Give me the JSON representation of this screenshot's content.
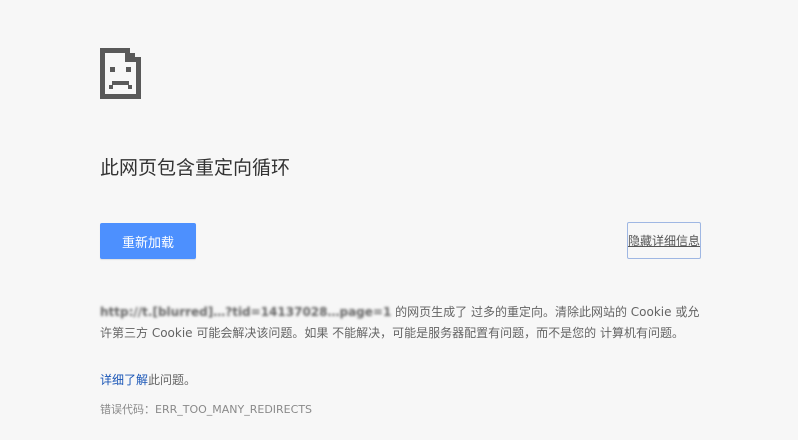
{
  "icon": "sad-page-icon",
  "heading": "此网页包含重定向循环",
  "buttons": {
    "reload_label": "重新加载",
    "details_label": "隐藏详细信息"
  },
  "details": {
    "url": "http://t.[blurred]…?tid=14137028…page=1",
    "message_after_url": " 的网页生成了 过多的重定向。清除此网站的 Cookie 或允许第三方 Cookie 可能会解决该问题。如果 不能解决，可能是服务器配置有问题，而不是您的 计算机有问题。"
  },
  "learn_more": {
    "link_text": "详细了解",
    "suffix": "此问题。"
  },
  "error_code": "错误代码：ERR_TOO_MANY_REDIRECTS",
  "colors": {
    "background": "#f7f7f7",
    "primary_button": "#4d90fe",
    "link": "#1a56b7"
  }
}
